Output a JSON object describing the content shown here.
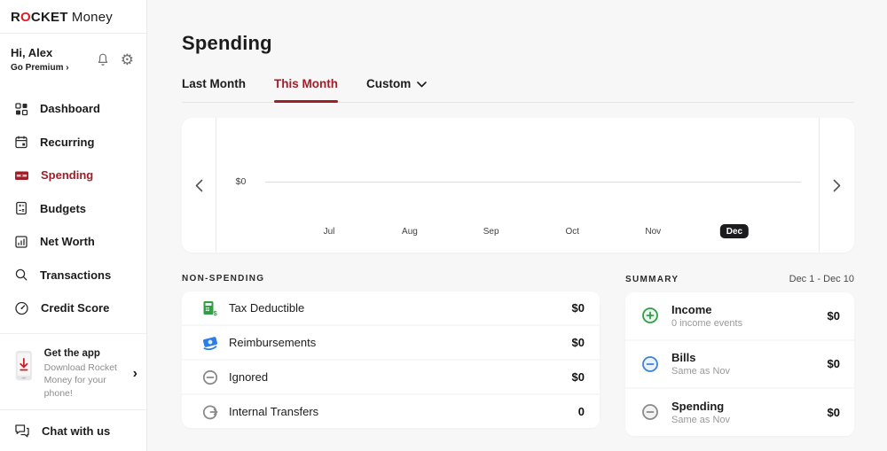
{
  "sidebar": {
    "logo": {
      "r": "R",
      "o": "O",
      "cket": "CKET",
      "money": " Money"
    },
    "greeting": "Hi, Alex",
    "premium_link": "Go Premium ›",
    "nav": [
      {
        "label": "Dashboard",
        "active": false
      },
      {
        "label": "Recurring",
        "active": false
      },
      {
        "label": "Spending",
        "active": true
      },
      {
        "label": "Budgets",
        "active": false
      },
      {
        "label": "Net Worth",
        "active": false
      },
      {
        "label": "Transactions",
        "active": false
      },
      {
        "label": "Credit Score",
        "active": false
      }
    ],
    "get_app": {
      "title": "Get the app",
      "description": "Download Rocket Money for your phone!",
      "chevron": "›"
    },
    "chat_label": "Chat with us"
  },
  "header": {
    "title": "Spending",
    "tabs": [
      {
        "label": "Last Month",
        "active": false
      },
      {
        "label": "This Month",
        "active": true
      },
      {
        "label": "Custom",
        "active": false,
        "has_dropdown": true
      }
    ]
  },
  "chart_data": {
    "type": "line",
    "categories": [
      "Jul",
      "Aug",
      "Sep",
      "Oct",
      "Nov",
      "Dec"
    ],
    "values": [
      0,
      0,
      0,
      0,
      0,
      0
    ],
    "selected_category": "Dec",
    "y_tick_label": "$0",
    "ylim": [
      0,
      0
    ],
    "grid": false,
    "title": "",
    "xlabel": "",
    "ylabel": ""
  },
  "nonspending": {
    "heading": "NON-SPENDING",
    "rows": [
      {
        "icon": "tax-deductible-icon",
        "label": "Tax Deductible",
        "value": "$0"
      },
      {
        "icon": "reimbursements-icon",
        "label": "Reimbursements",
        "value": "$0"
      },
      {
        "icon": "ignored-icon",
        "label": "Ignored",
        "value": "$0"
      },
      {
        "icon": "internal-transfers-icon",
        "label": "Internal Transfers",
        "value": "0"
      }
    ]
  },
  "summary": {
    "heading": "SUMMARY",
    "date_range": "Dec 1 - Dec 10",
    "rows": [
      {
        "icon": "income-icon",
        "label": "Income",
        "subtitle": "0 income events",
        "value": "$0"
      },
      {
        "icon": "bills-icon",
        "label": "Bills",
        "subtitle": "Same as Nov",
        "value": "$0"
      },
      {
        "icon": "spending-icon",
        "label": "Spending",
        "subtitle": "Same as Nov",
        "value": "$0"
      }
    ]
  },
  "colors": {
    "accent_red": "#9e1f28",
    "logo_red": "#e11b22",
    "badge_dark": "#1c1c1e",
    "green": "#2f9e44",
    "blue": "#2b7de9",
    "gray_icon": "#8a8a8a",
    "main_bg": "#f7f7f8"
  }
}
